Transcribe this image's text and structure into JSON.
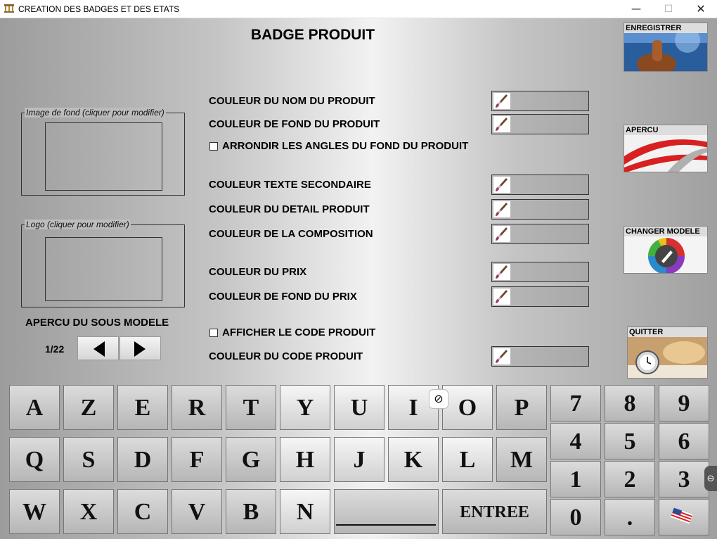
{
  "window": {
    "title": "CREATION DES BADGES ET DES ETATS",
    "min": "—",
    "max": "☐",
    "close": "✕"
  },
  "heading": "BADGE PRODUIT",
  "groups": {
    "background": "Image de fond (cliquer pour modifier)",
    "logo": "Logo (cliquer pour modifier)"
  },
  "submodel": {
    "label": "APERCU DU SOUS MODELE",
    "page": "1/22"
  },
  "rows": [
    "COULEUR DU NOM DU PRODUIT",
    "COULEUR DE FOND DU PRODUIT",
    "ARRONDIR LES ANGLES DU FOND DU PRODUIT",
    "COULEUR TEXTE SECONDAIRE",
    "COULEUR DU DETAIL PRODUIT",
    "COULEUR DE LA COMPOSITION",
    "COULEUR DU PRIX",
    "COULEUR DE FOND DU PRIX",
    "AFFICHER LE CODE PRODUIT",
    "COULEUR DU CODE PRODUIT"
  ],
  "checkboxes": {
    "round_corners": false,
    "show_code": false
  },
  "actions": {
    "save": "ENREGISTRER",
    "preview": "APERCU",
    "change_model": "CHANGER MODELE",
    "quit": "QUITTER"
  },
  "keyboard": {
    "row1": [
      "A",
      "Z",
      "E",
      "R",
      "T",
      "Y",
      "U",
      "I",
      "O",
      "P"
    ],
    "row2": [
      "Q",
      "S",
      "D",
      "F",
      "G",
      "H",
      "J",
      "K",
      "L",
      "M"
    ],
    "row3": [
      "W",
      "X",
      "C",
      "V",
      "B",
      "N"
    ],
    "enter": "ENTREE",
    "numpad": [
      "7",
      "8",
      "9",
      "4",
      "5",
      "6",
      "1",
      "2",
      "3",
      "0",
      "."
    ]
  },
  "icons": [
    "app-icon",
    "brush-icon",
    "arrow-left-icon",
    "arrow-right-icon",
    "flag-icon",
    "cancel-icon"
  ],
  "colors": {
    "accent_red": "#d82020",
    "key_face": "#d0d0d0"
  }
}
